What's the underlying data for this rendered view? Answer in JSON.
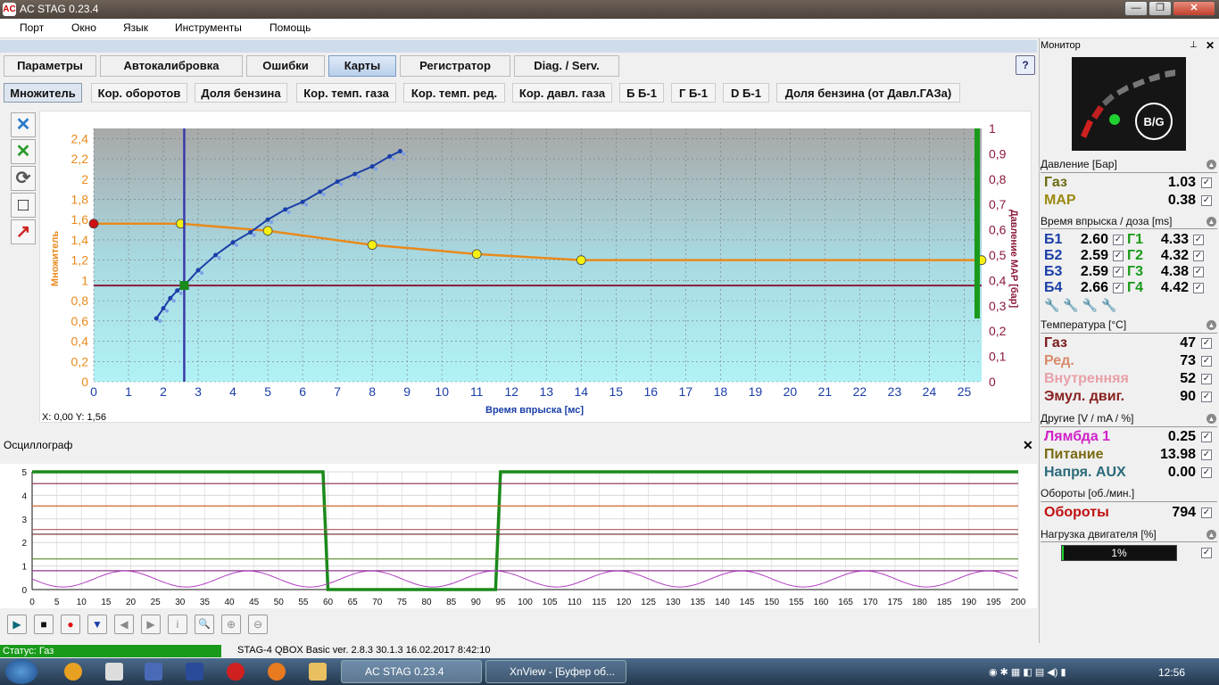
{
  "window": {
    "title": "AC STAG 0.23.4",
    "icon": "ac-stag-icon",
    "btn_min": "—",
    "btn_max": "❐",
    "btn_close": "✕"
  },
  "menu": {
    "items": [
      "Порт",
      "Окно",
      "Язык",
      "Инструменты",
      "Помощь"
    ]
  },
  "tabs": [
    "Параметры",
    "Автокалибровка",
    "Ошибки",
    "Карты",
    "Регистратор",
    "Diag. / Serv."
  ],
  "active_tab": "Карты",
  "subtabs": [
    "Множитель",
    "Кор. оборотов",
    "Доля бензина",
    "Кор. темп. газа",
    "Кор. темп. ред.",
    "Кор. давл. газа",
    "Б Б-1",
    "Г Б-1",
    "D Б-1",
    "Доля бензина (от Давл.ГАЗа)"
  ],
  "active_subtab": "Множитель",
  "help_label": "?",
  "map_chart": {
    "ylabel_left": "Множитель",
    "ylabel_right": "Давление MAP [бар]",
    "xlabel": "Время впрыска [мс]",
    "coords": "X: 0,00  Y: 1,56",
    "left_ticks": [
      "2,4",
      "2,2",
      "2",
      "1,8",
      "1,6",
      "1,4",
      "1,2",
      "1",
      "0,8",
      "0,6",
      "0,4",
      "0,2",
      "0"
    ],
    "right_ticks": [
      "1",
      "0,9",
      "0,8",
      "0,7",
      "0,6",
      "0,5",
      "0,4",
      "0,3",
      "0,2",
      "0,1",
      "0"
    ],
    "x_ticks": [
      "0",
      "1",
      "2",
      "3",
      "4",
      "5",
      "6",
      "7",
      "8",
      "9",
      "10",
      "11",
      "12",
      "13",
      "14",
      "15",
      "16",
      "17",
      "18",
      "19",
      "20",
      "21",
      "22",
      "23",
      "24",
      "25"
    ]
  },
  "chart_data": [
    {
      "type": "line",
      "title": "",
      "xlabel": "Время впрыска [мс]",
      "ylabel": "Множитель",
      "y2label": "Давление MAP [бар]",
      "xlim": [
        0,
        25.5
      ],
      "ylim": [
        0,
        2.5
      ],
      "y2lim": [
        0,
        1
      ],
      "grid": true,
      "series": [
        {
          "axis": "left",
          "color": "#e88a1c",
          "points": [
            [
              0,
              1.56
            ],
            [
              2.5,
              1.56
            ],
            [
              5,
              1.49
            ],
            [
              8,
              1.35
            ],
            [
              11,
              1.26
            ],
            [
              14,
              1.2
            ],
            [
              25.5,
              1.2
            ]
          ]
        },
        {
          "axis": "right",
          "color": "#1a3ea8",
          "points": [
            [
              1.8,
              0.25
            ],
            [
              2.0,
              0.29
            ],
            [
              2.2,
              0.33
            ],
            [
              2.4,
              0.36
            ],
            [
              2.6,
              0.38
            ],
            [
              3.0,
              0.44
            ],
            [
              3.5,
              0.5
            ],
            [
              4.0,
              0.55
            ],
            [
              4.5,
              0.59
            ],
            [
              5.0,
              0.64
            ],
            [
              5.5,
              0.68
            ],
            [
              6.0,
              0.71
            ],
            [
              6.5,
              0.75
            ],
            [
              7.0,
              0.79
            ],
            [
              7.5,
              0.82
            ],
            [
              8.0,
              0.85
            ],
            [
              8.5,
              0.89
            ],
            [
              8.8,
              0.91
            ]
          ]
        },
        {
          "axis": "left",
          "color": "#8a1a3a",
          "points": [
            [
              0,
              0.95
            ],
            [
              25.5,
              0.95
            ]
          ]
        },
        {
          "axis": "x-vertical",
          "color": "#3a3aa8",
          "points": [
            [
              2.6,
              0
            ],
            [
              2.6,
              2.5
            ]
          ]
        }
      ]
    },
    {
      "type": "line",
      "title": "Осциллограф",
      "xlim": [
        0,
        200
      ],
      "ylim": [
        0,
        5
      ],
      "x_ticks": [
        "0",
        "5",
        "10",
        "15",
        "20",
        "25",
        "30",
        "35",
        "40",
        "45",
        "50",
        "55",
        "60",
        "65",
        "70",
        "75",
        "80",
        "85",
        "90",
        "95",
        "100",
        "105",
        "110",
        "115",
        "120",
        "125",
        "130",
        "135",
        "140",
        "145",
        "150",
        "155",
        "160",
        "165",
        "170",
        "175",
        "180",
        "185",
        "190",
        "195",
        "200"
      ],
      "y_ticks": [
        "5",
        "4",
        "3",
        "2",
        "1",
        "0"
      ],
      "series": [
        {
          "color": "#1a8a1a",
          "points": [
            [
              0,
              5
            ],
            [
              59,
              5
            ],
            [
              60,
              0
            ],
            [
              94,
              0
            ],
            [
              95,
              5
            ],
            [
              200,
              5
            ]
          ]
        },
        {
          "color": "#8a2a4a",
          "points": [
            [
              0,
              4.5
            ],
            [
              200,
              4.5
            ]
          ]
        },
        {
          "color": "#c86a2a",
          "points": [
            [
              0,
              3.55
            ],
            [
              200,
              3.55
            ]
          ]
        },
        {
          "color": "#6a2a2a",
          "points": [
            [
              0,
              2.35
            ],
            [
              200,
              2.35
            ]
          ]
        },
        {
          "color": "#a85a5a",
          "points": [
            [
              0,
              2.55
            ],
            [
              200,
              2.55
            ]
          ]
        },
        {
          "color": "#5a8a2a",
          "points": [
            [
              0,
              1.3
            ],
            [
              200,
              1.3
            ]
          ]
        },
        {
          "color": "#8a3a8a",
          "points": [
            [
              0,
              0.8
            ],
            [
              200,
              0.8
            ]
          ]
        }
      ]
    }
  ],
  "oscillograph": {
    "title": "Осциллограф",
    "close": "✕"
  },
  "controls": [
    "▶",
    "■",
    "●",
    "▼",
    "◀",
    "▶",
    "i",
    "🔍",
    "⊕",
    "⊖"
  ],
  "status": {
    "text": "Статус: Газ",
    "version": "STAG-4 QBOX Basic  ver. 2.8.3  30.1.3  16.02.2017 8:42:10"
  },
  "monitor": {
    "title": "Монитор",
    "gauge_label": "B/G",
    "pressure": {
      "title": "Давление [Бар]",
      "gas_label": "Газ",
      "gas": "1.03",
      "map_label": "MAP",
      "map": "0.38"
    },
    "injection": {
      "title": "Время впрыска / доза [ms]",
      "rows": [
        {
          "b": "Б1",
          "bv": "2.60",
          "g": "Г1",
          "gv": "4.33"
        },
        {
          "b": "Б2",
          "bv": "2.59",
          "g": "Г2",
          "gv": "4.32"
        },
        {
          "b": "Б3",
          "bv": "2.59",
          "g": "Г3",
          "gv": "4.38"
        },
        {
          "b": "Б4",
          "bv": "2.66",
          "g": "Г4",
          "gv": "4.42"
        }
      ]
    },
    "temperature": {
      "title": "Температура [°C]",
      "rows": [
        {
          "label": "Газ",
          "value": "47",
          "color": "#7a1a1a"
        },
        {
          "label": "Ред.",
          "value": "73",
          "color": "#d88a6a"
        },
        {
          "label": "Внутренняя",
          "value": "52",
          "color": "#e8a0a8"
        },
        {
          "label": "Эмул. двиг.",
          "value": "90",
          "color": "#8a2020"
        }
      ]
    },
    "other": {
      "title": "Другие [V / mA / %]",
      "rows": [
        {
          "label": "Лямбда 1",
          "value": "0.25",
          "color": "#d020c8"
        },
        {
          "label": "Питание",
          "value": "13.98",
          "color": "#7a6a10"
        },
        {
          "label": "Напря. AUX",
          "value": "0.00",
          "color": "#2a6a7a"
        }
      ]
    },
    "rpm": {
      "title": "Обороты [об./мин.]",
      "label": "Обороты",
      "value": "794"
    },
    "load": {
      "title": "Нагрузка двигателя [%]",
      "value": "1%",
      "fraction": 0.01
    }
  },
  "taskbar": {
    "tasks": [
      {
        "label": "AC STAG 0.23.4"
      },
      {
        "label": "XnView - [Буфер об..."
      }
    ],
    "clock": "12:56"
  }
}
